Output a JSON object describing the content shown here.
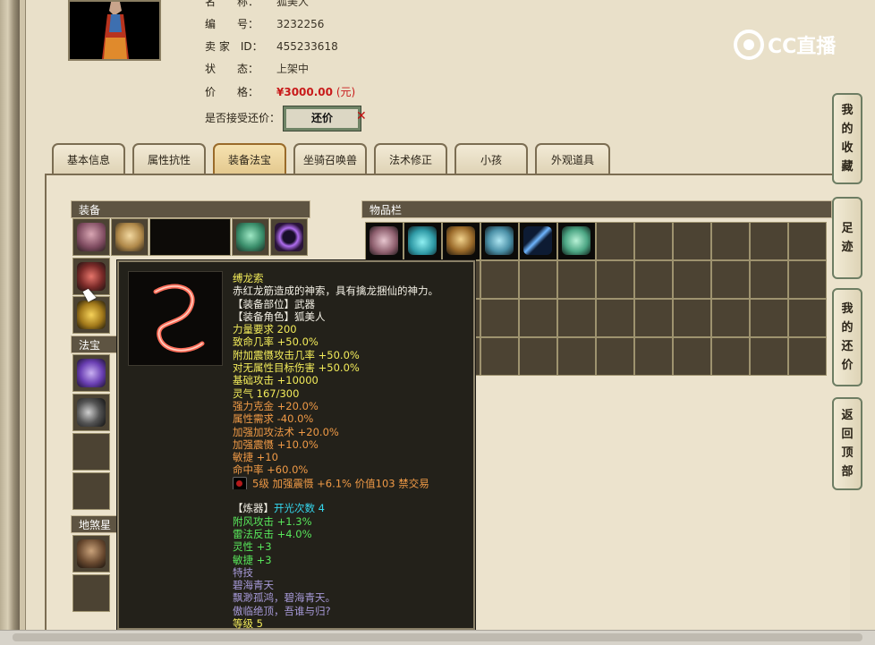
{
  "header": {
    "portrait_alt": "character-portrait",
    "fields": [
      {
        "label": "名　　称：",
        "value": "狐美人"
      },
      {
        "label": "编　　号：",
        "value": "3232256"
      },
      {
        "label": "卖 家　ID：",
        "value": "455233618"
      },
      {
        "label": "状　　态：",
        "value": "上架中"
      },
      {
        "label": "价　　格：",
        "value": "¥3000.00",
        "unit": "(元)"
      }
    ],
    "bargain_label": "是否接受还价：",
    "bargain_button": "还价"
  },
  "watermark": "CC直播",
  "tabs": [
    {
      "label": "基本信息",
      "active": false
    },
    {
      "label": "属性抗性",
      "active": false
    },
    {
      "label": "装备法宝",
      "active": true
    },
    {
      "label": "坐骑召唤兽",
      "active": false
    },
    {
      "label": "法术修正",
      "active": false
    },
    {
      "label": "小孩",
      "active": false
    },
    {
      "label": "外观道具",
      "active": false
    }
  ],
  "sections": {
    "equipment": "装备",
    "magic_treasure": "法宝",
    "earth_star": "地煞星",
    "inventory": "物品栏"
  },
  "tooltip": {
    "lines": [
      {
        "text": "缚龙索",
        "color": "yellow"
      },
      {
        "text": "赤红龙筋造成的神索，具有擒龙捆仙的神力。",
        "color": "white"
      },
      {
        "text": "【装备部位】武器",
        "color": "white"
      },
      {
        "text": "【装备角色】狐美人",
        "color": "white"
      },
      {
        "text": "力量要求 200",
        "color": "yellow"
      },
      {
        "text": "致命几率 +50.0%",
        "color": "yellow"
      },
      {
        "text": "附加震慑攻击几率 +50.0%",
        "color": "yellow"
      },
      {
        "text": "对无属性目标伤害 +50.0%",
        "color": "yellow"
      },
      {
        "text": "基础攻击 +10000",
        "color": "yellow"
      },
      {
        "text": "灵气 167/300",
        "color": "yellow"
      },
      {
        "text": "强力克金 +20.0%",
        "color": "orange"
      },
      {
        "text": "属性需求 -40.0%",
        "color": "orange"
      },
      {
        "text": "加强加攻法术 +20.0%",
        "color": "orange"
      },
      {
        "text": "加强震慑 +10.0%",
        "color": "orange"
      },
      {
        "text": "敏捷 +10",
        "color": "orange"
      },
      {
        "text": "命中率 +60.0%",
        "color": "orange"
      },
      {
        "text": "5级 加强震慑 +6.1% 价值103 禁交易",
        "color": "orange",
        "gem": true
      },
      {
        "text": "",
        "color": "white"
      },
      {
        "text_prefix": "【炼器】",
        "text": "开光次数 4",
        "color": "cyan"
      },
      {
        "text": "附风攻击 +1.3%",
        "color": "green"
      },
      {
        "text": "雷法反击 +4.0%",
        "color": "green"
      },
      {
        "text": "灵性 +3",
        "color": "green"
      },
      {
        "text": "敏捷 +3",
        "color": "green"
      },
      {
        "text": "特技",
        "color": "purple"
      },
      {
        "text": "碧海青天",
        "color": "purple"
      },
      {
        "text": "飘渺孤鸿，碧海青天。",
        "color": "purple"
      },
      {
        "text": "傲临绝顶，吾谁与归?",
        "color": "purple"
      },
      {
        "text": "等级 5",
        "color": "yellow"
      }
    ]
  },
  "side_buttons": [
    {
      "label": "我的收藏"
    },
    {
      "label": "足迹"
    },
    {
      "label": "我的还价"
    },
    {
      "label": "返回顶部"
    }
  ],
  "colors": {
    "price": "#c81a1a",
    "panel_bg": "#ece3cd",
    "section_head": "#5e5442",
    "cell": "#4c4333",
    "tooltip_bg": "#23211a"
  }
}
